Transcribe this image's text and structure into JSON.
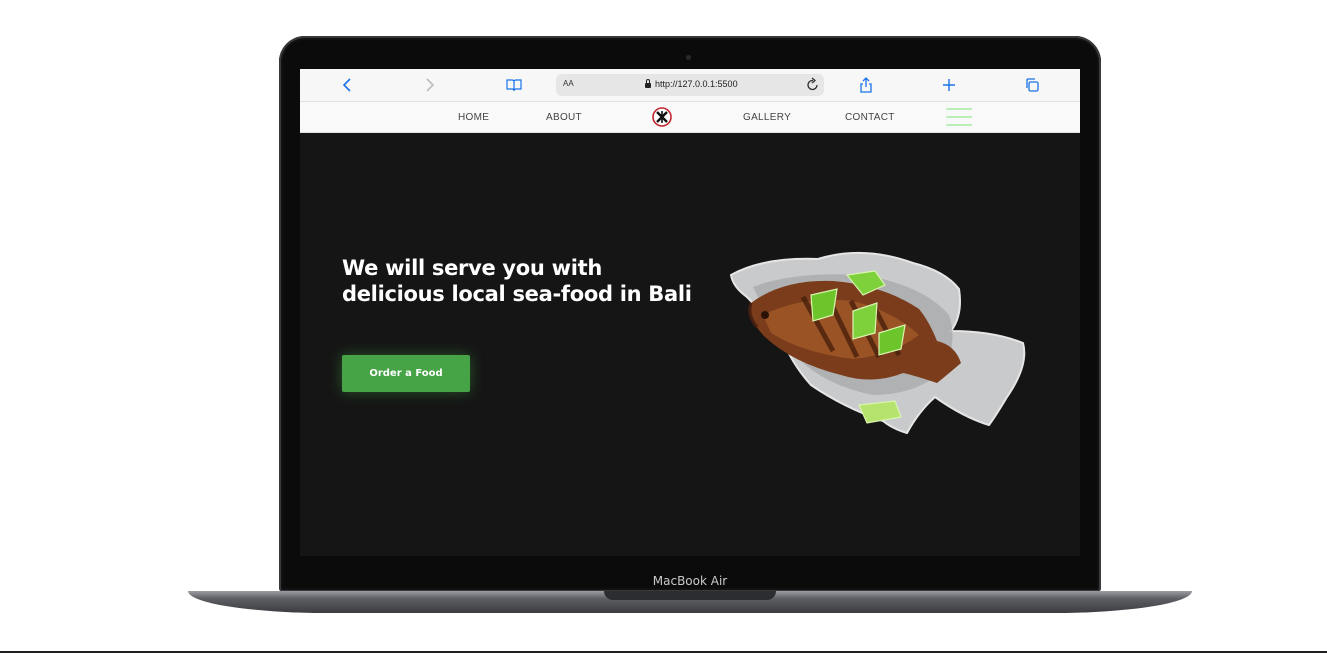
{
  "device": {
    "label": "MacBook Air"
  },
  "browser": {
    "text_size_label": "AA",
    "url": "http://127.0.0.1:5500",
    "icons": [
      "back-icon",
      "forward-icon",
      "bookmarks-icon",
      "lock-icon",
      "reload-icon",
      "share-icon",
      "new-tab-icon",
      "tabs-icon"
    ],
    "accent": "#1a73e8"
  },
  "nav": {
    "links": [
      "HOME",
      "ABOUT",
      "GALLERY",
      "CONTACT"
    ],
    "logo": "restaurant-logo-icon",
    "menu_icon": "hamburger-icon"
  },
  "hero": {
    "title_line1": "We will serve you with",
    "title_line2": "delicious local sea-food in Bali",
    "cta_label": "Order a Food",
    "cta_color": "#46a447",
    "image": "fried-fish-plate-image"
  },
  "colors": {
    "page_bg": "#151515",
    "nav_bg": "#f9f9f9"
  }
}
